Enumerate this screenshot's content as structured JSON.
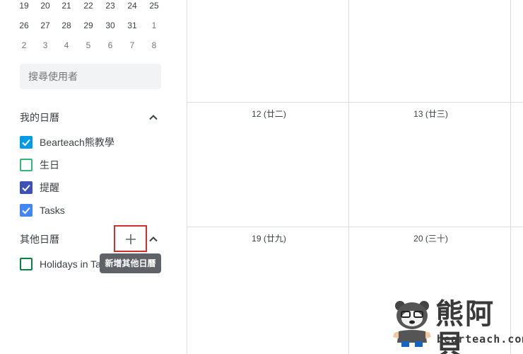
{
  "mini_calendar": {
    "rows": [
      [
        {
          "d": "19"
        },
        {
          "d": "20"
        },
        {
          "d": "21"
        },
        {
          "d": "22"
        },
        {
          "d": "23"
        },
        {
          "d": "24"
        },
        {
          "d": "25"
        }
      ],
      [
        {
          "d": "26"
        },
        {
          "d": "27"
        },
        {
          "d": "28"
        },
        {
          "d": "29"
        },
        {
          "d": "30"
        },
        {
          "d": "31"
        },
        {
          "d": "1",
          "other": true
        }
      ],
      [
        {
          "d": "2",
          "other": true
        },
        {
          "d": "3",
          "other": true
        },
        {
          "d": "4",
          "other": true
        },
        {
          "d": "5",
          "other": true
        },
        {
          "d": "6",
          "other": true
        },
        {
          "d": "7",
          "other": true
        },
        {
          "d": "8",
          "other": true
        }
      ]
    ]
  },
  "search": {
    "placeholder": "搜尋使用者"
  },
  "my_calendars": {
    "title": "我的日曆",
    "items": [
      {
        "label": "Bearteach熊教學",
        "checked": true,
        "color": "#039be5"
      },
      {
        "label": "生日",
        "checked": false,
        "color": "#33b679"
      },
      {
        "label": "提醒",
        "checked": true,
        "color": "#3f51b5"
      },
      {
        "label": "Tasks",
        "checked": true,
        "color": "#4285f4"
      }
    ]
  },
  "other_calendars": {
    "title": "其他日曆",
    "add_tooltip": "新增其他日曆",
    "items": [
      {
        "label": "Holidays in Ta",
        "checked": false,
        "color": "#0b8043"
      }
    ]
  },
  "grid": {
    "dates": [
      {
        "label": "12 (廿二)"
      },
      {
        "label": "13 (廿三)"
      },
      {
        "label": "19 (廿九)"
      },
      {
        "label": "20 (三十)"
      }
    ]
  },
  "watermark": {
    "name": "熊阿貝",
    "url": "bearteach.com"
  },
  "colors": {
    "accent_red": "#d32f2f",
    "grid_line": "#dadce0",
    "tooltip_bg": "#5f6368"
  }
}
